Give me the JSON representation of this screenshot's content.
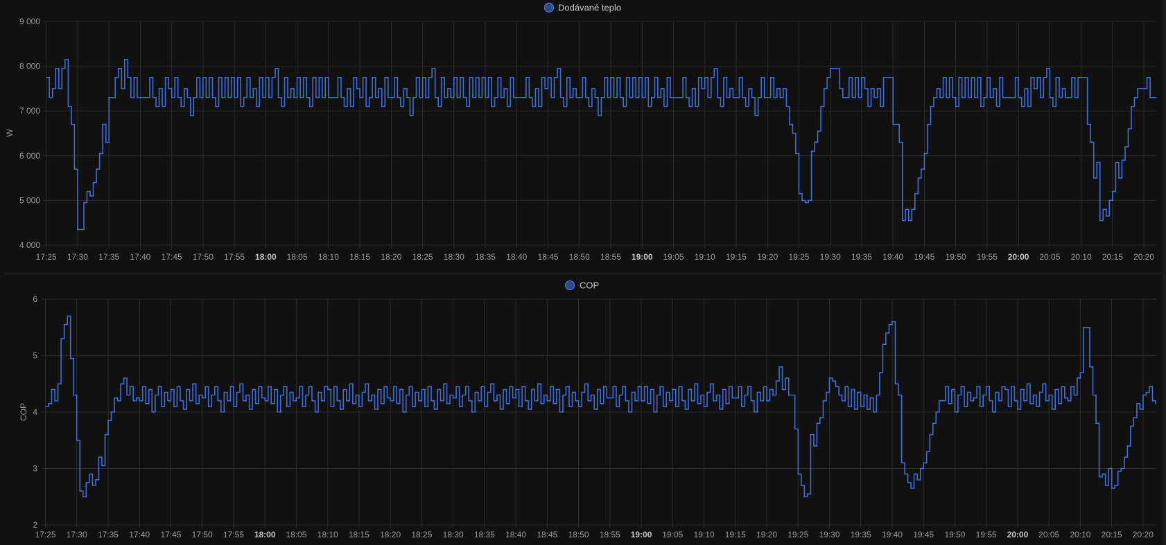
{
  "colors": {
    "background": "#111111",
    "line": "#3f6fd6",
    "legend_fill": "#2f4a8a",
    "grid": "#2c2c2c"
  },
  "chart_data": [
    {
      "type": "line",
      "step": true,
      "legend": "Dodávané teplo",
      "legend_placement": "top-center",
      "ylabel": "W",
      "xlabel": "",
      "ylim": [
        4000,
        9000
      ],
      "y_ticks": [
        {
          "v": 9000,
          "label": "9 000"
        },
        {
          "v": 8000,
          "label": "8 000"
        },
        {
          "v": 7000,
          "label": "7 000"
        },
        {
          "v": 6000,
          "label": "6 000"
        },
        {
          "v": 5000,
          "label": "5 000"
        },
        {
          "v": 4000,
          "label": "4 000"
        }
      ],
      "x_start": "17:25",
      "x_step_minutes": 0.5,
      "xlim_minutes": [
        0,
        177.5
      ],
      "values": [
        7750,
        7300,
        7500,
        7950,
        7500,
        7950,
        8150,
        7100,
        6700,
        5700,
        4350,
        4350,
        4950,
        5200,
        5100,
        5400,
        5700,
        6050,
        6700,
        6300,
        7300,
        7300,
        7750,
        7950,
        7500,
        8150,
        7750,
        7300,
        7750,
        7300,
        7300,
        7300,
        7300,
        7750,
        7300,
        7100,
        7500,
        7100,
        7750,
        7500,
        7300,
        7750,
        7300,
        7100,
        7500,
        7300,
        6900,
        7300,
        7750,
        7300,
        7750,
        7300,
        7750,
        7300,
        7100,
        7750,
        7300,
        7750,
        7300,
        7750,
        7300,
        7750,
        7100,
        7300,
        7750,
        7300,
        7500,
        7100,
        7750,
        7300,
        7750,
        7300,
        7750,
        7950,
        7300,
        7100,
        7750,
        7300,
        7500,
        7300,
        7750,
        7300,
        7750,
        7300,
        7100,
        7750,
        7300,
        7750,
        7300,
        7750,
        7300,
        7300,
        7300,
        7750,
        7300,
        7100,
        7500,
        7100,
        7750,
        7500,
        7300,
        7750,
        7100,
        7300,
        7750,
        7300,
        7500,
        7100,
        7750,
        7300,
        7300,
        7750,
        7300,
        7100,
        7500,
        7300,
        6900,
        7300,
        7750,
        7300,
        7750,
        7300,
        7750,
        7950,
        7300,
        7100,
        7750,
        7300,
        7500,
        7300,
        7750,
        7300,
        7750,
        7300,
        7100,
        7750,
        7300,
        7750,
        7300,
        7750,
        7300,
        7750,
        7100,
        7300,
        7750,
        7300,
        7500,
        7100,
        7750,
        7300,
        7300,
        7300,
        7300,
        7750,
        7300,
        7100,
        7500,
        7100,
        7750,
        7500,
        7750,
        7300,
        7750,
        7950,
        7300,
        7100,
        7750,
        7300,
        7500,
        7300,
        7300,
        7750,
        7300,
        7100,
        7500,
        7300,
        6900,
        7300,
        7750,
        7300,
        7750,
        7300,
        7750,
        7300,
        7100,
        7750,
        7300,
        7750,
        7300,
        7750,
        7300,
        7750,
        7100,
        7300,
        7750,
        7300,
        7500,
        7100,
        7750,
        7300,
        7300,
        7300,
        7300,
        7750,
        7300,
        7100,
        7500,
        7100,
        7750,
        7500,
        7750,
        7300,
        7750,
        7950,
        7300,
        7100,
        7750,
        7300,
        7500,
        7300,
        7300,
        7750,
        7300,
        7100,
        7500,
        7300,
        6900,
        7300,
        7750,
        7300,
        7300,
        7750,
        7300,
        7500,
        7300,
        7500,
        7100,
        6700,
        6500,
        6050,
        5150,
        5000,
        4950,
        5000,
        6100,
        6300,
        6550,
        7100,
        7500,
        7750,
        7950,
        7950,
        7950,
        7500,
        7300,
        7300,
        7750,
        7300,
        7750,
        7300,
        7750,
        7500,
        7100,
        7500,
        7300,
        7500,
        7100,
        7750,
        7750,
        7750,
        6700,
        6700,
        6300,
        4550,
        4800,
        4550,
        4800,
        5150,
        5500,
        5700,
        6050,
        6700,
        7100,
        7300,
        7500,
        7300,
        7750,
        7300,
        7750,
        7300,
        7100,
        7750,
        7300,
        7750,
        7300,
        7750,
        7300,
        7750,
        7100,
        7300,
        7750,
        7300,
        7500,
        7100,
        7750,
        7300,
        7300,
        7300,
        7300,
        7750,
        7300,
        7100,
        7500,
        7100,
        7750,
        7500,
        7750,
        7300,
        7750,
        7950,
        7300,
        7100,
        7750,
        7300,
        7500,
        7300,
        7300,
        7750,
        7300,
        7750,
        7750,
        7750,
        6700,
        6300,
        5500,
        5850,
        4550,
        4800,
        4650,
        5000,
        5200,
        5850,
        5500,
        5900,
        6200,
        6600,
        7100,
        7300,
        7500,
        7500,
        7500,
        7750,
        7300,
        7300,
        7300
      ],
      "x_ticks": [
        {
          "m": 0,
          "label": "17:25"
        },
        {
          "m": 5,
          "label": "17:30"
        },
        {
          "m": 10,
          "label": "17:35"
        },
        {
          "m": 15,
          "label": "17:40"
        },
        {
          "m": 20,
          "label": "17:45"
        },
        {
          "m": 25,
          "label": "17:50"
        },
        {
          "m": 30,
          "label": "17:55"
        },
        {
          "m": 35,
          "label": "18:00",
          "bold": true
        },
        {
          "m": 40,
          "label": "18:05"
        },
        {
          "m": 45,
          "label": "18:10"
        },
        {
          "m": 50,
          "label": "18:15"
        },
        {
          "m": 55,
          "label": "18:20"
        },
        {
          "m": 60,
          "label": "18:25"
        },
        {
          "m": 65,
          "label": "18:30"
        },
        {
          "m": 70,
          "label": "18:35"
        },
        {
          "m": 75,
          "label": "18:40"
        },
        {
          "m": 80,
          "label": "18:45"
        },
        {
          "m": 85,
          "label": "18:50"
        },
        {
          "m": 90,
          "label": "18:55"
        },
        {
          "m": 95,
          "label": "19:00",
          "bold": true
        },
        {
          "m": 100,
          "label": "19:05"
        },
        {
          "m": 105,
          "label": "19:10"
        },
        {
          "m": 110,
          "label": "19:15"
        },
        {
          "m": 115,
          "label": "19:20"
        },
        {
          "m": 120,
          "label": "19:25"
        },
        {
          "m": 125,
          "label": "19:30"
        },
        {
          "m": 130,
          "label": "19:35"
        },
        {
          "m": 135,
          "label": "19:40"
        },
        {
          "m": 140,
          "label": "19:45"
        },
        {
          "m": 145,
          "label": "19:50"
        },
        {
          "m": 150,
          "label": "19:55"
        },
        {
          "m": 155,
          "label": "20:00",
          "bold": true
        },
        {
          "m": 160,
          "label": "20:05"
        },
        {
          "m": 165,
          "label": "20:10"
        },
        {
          "m": 170,
          "label": "20:15"
        },
        {
          "m": 175,
          "label": "20:20"
        }
      ]
    },
    {
      "type": "line",
      "step": true,
      "legend": "COP",
      "legend_placement": "top-center",
      "ylabel": "COP",
      "xlabel": "",
      "ylim": [
        2,
        6
      ],
      "y_ticks": [
        {
          "v": 6,
          "label": "6"
        },
        {
          "v": 5,
          "label": "5"
        },
        {
          "v": 4,
          "label": "4"
        },
        {
          "v": 3,
          "label": "3"
        },
        {
          "v": 2,
          "label": "2"
        }
      ],
      "x_start": "17:25",
      "x_step_minutes": 0.5,
      "xlim_minutes": [
        0,
        177.5
      ],
      "values": [
        4.1,
        4.15,
        4.4,
        4.2,
        4.5,
        5.3,
        5.55,
        5.7,
        4.95,
        4.3,
        3.5,
        2.6,
        2.5,
        2.75,
        2.9,
        2.7,
        2.8,
        3.2,
        3.05,
        3.6,
        3.85,
        4.0,
        4.25,
        4.2,
        4.5,
        4.6,
        4.3,
        4.45,
        4.2,
        4.25,
        4.2,
        4.45,
        4.15,
        4.4,
        4.0,
        4.3,
        4.45,
        4.1,
        4.35,
        4.2,
        4.4,
        4.1,
        4.45,
        4.2,
        4.05,
        4.4,
        4.2,
        4.5,
        4.15,
        4.3,
        4.25,
        4.45,
        4.1,
        4.3,
        4.45,
        4.2,
        4.0,
        4.35,
        4.2,
        4.45,
        4.1,
        4.35,
        4.5,
        4.2,
        4.3,
        4.05,
        4.4,
        4.15,
        4.45,
        4.25,
        4.2,
        4.45,
        4.15,
        4.4,
        4.0,
        4.3,
        4.45,
        4.1,
        4.35,
        4.2,
        4.25,
        4.45,
        4.1,
        4.3,
        4.45,
        4.2,
        4.0,
        4.35,
        4.2,
        4.45,
        4.4,
        4.1,
        4.45,
        4.2,
        4.05,
        4.4,
        4.2,
        4.5,
        4.15,
        4.3,
        4.1,
        4.35,
        4.5,
        4.2,
        4.3,
        4.05,
        4.4,
        4.15,
        4.45,
        4.25,
        4.2,
        4.45,
        4.15,
        4.4,
        4.0,
        4.3,
        4.45,
        4.1,
        4.35,
        4.2,
        4.4,
        4.1,
        4.45,
        4.2,
        4.05,
        4.4,
        4.2,
        4.5,
        4.15,
        4.3,
        4.25,
        4.45,
        4.1,
        4.3,
        4.45,
        4.2,
        4.0,
        4.35,
        4.2,
        4.45,
        4.1,
        4.35,
        4.5,
        4.2,
        4.3,
        4.05,
        4.4,
        4.15,
        4.45,
        4.25,
        4.4,
        4.1,
        4.45,
        4.2,
        4.05,
        4.4,
        4.2,
        4.5,
        4.15,
        4.3,
        4.2,
        4.45,
        4.15,
        4.4,
        4.0,
        4.3,
        4.45,
        4.1,
        4.35,
        4.2,
        4.1,
        4.35,
        4.5,
        4.2,
        4.3,
        4.05,
        4.4,
        4.15,
        4.45,
        4.25,
        4.25,
        4.45,
        4.1,
        4.3,
        4.45,
        4.2,
        4.0,
        4.35,
        4.2,
        4.45,
        4.2,
        4.45,
        4.15,
        4.4,
        4.0,
        4.3,
        4.45,
        4.1,
        4.35,
        4.2,
        4.4,
        4.1,
        4.45,
        4.2,
        4.05,
        4.4,
        4.2,
        4.5,
        4.15,
        4.3,
        4.1,
        4.35,
        4.5,
        4.2,
        4.3,
        4.05,
        4.4,
        4.15,
        4.45,
        4.25,
        4.25,
        4.45,
        4.1,
        4.3,
        4.45,
        4.2,
        4.0,
        4.35,
        4.2,
        4.45,
        4.2,
        4.4,
        4.3,
        4.55,
        4.8,
        4.4,
        4.6,
        4.3,
        4.3,
        3.7,
        2.9,
        2.7,
        2.5,
        2.55,
        3.6,
        3.4,
        3.8,
        3.9,
        4.2,
        4.35,
        4.6,
        4.55,
        4.45,
        4.3,
        4.2,
        4.45,
        4.1,
        4.4,
        4.05,
        4.35,
        4.1,
        4.3,
        4.05,
        4.25,
        4.0,
        4.3,
        4.7,
        5.2,
        5.4,
        5.55,
        5.6,
        4.5,
        4.3,
        3.1,
        2.9,
        2.75,
        2.65,
        2.9,
        2.8,
        3.0,
        3.1,
        3.3,
        3.6,
        3.8,
        4.0,
        4.2,
        4.2,
        4.45,
        4.15,
        4.4,
        4.0,
        4.3,
        4.45,
        4.1,
        4.35,
        4.2,
        4.25,
        4.45,
        4.1,
        4.3,
        4.45,
        4.2,
        4.0,
        4.35,
        4.2,
        4.45,
        4.4,
        4.1,
        4.45,
        4.2,
        4.05,
        4.4,
        4.2,
        4.5,
        4.15,
        4.3,
        4.1,
        4.35,
        4.5,
        4.2,
        4.3,
        4.05,
        4.4,
        4.15,
        4.45,
        4.25,
        4.2,
        4.45,
        4.3,
        4.6,
        4.7,
        5.5,
        5.5,
        4.8,
        4.3,
        3.8,
        2.85,
        2.9,
        2.7,
        3.0,
        2.65,
        2.7,
        2.95,
        3.0,
        3.2,
        3.4,
        3.75,
        3.9,
        4.15,
        4.05,
        4.3,
        4.35,
        4.45,
        4.2,
        4.15
      ],
      "x_ticks": [
        {
          "m": 0,
          "label": "17:25"
        },
        {
          "m": 5,
          "label": "17:30"
        },
        {
          "m": 10,
          "label": "17:35"
        },
        {
          "m": 15,
          "label": "17:40"
        },
        {
          "m": 20,
          "label": "17:45"
        },
        {
          "m": 25,
          "label": "17:50"
        },
        {
          "m": 30,
          "label": "17:55"
        },
        {
          "m": 35,
          "label": "18:00",
          "bold": true
        },
        {
          "m": 40,
          "label": "18:05"
        },
        {
          "m": 45,
          "label": "18:10"
        },
        {
          "m": 50,
          "label": "18:15"
        },
        {
          "m": 55,
          "label": "18:20"
        },
        {
          "m": 60,
          "label": "18:25"
        },
        {
          "m": 65,
          "label": "18:30"
        },
        {
          "m": 70,
          "label": "18:35"
        },
        {
          "m": 75,
          "label": "18:40"
        },
        {
          "m": 80,
          "label": "18:45"
        },
        {
          "m": 85,
          "label": "18:50"
        },
        {
          "m": 90,
          "label": "18:55"
        },
        {
          "m": 95,
          "label": "19:00",
          "bold": true
        },
        {
          "m": 100,
          "label": "19:05"
        },
        {
          "m": 105,
          "label": "19:10"
        },
        {
          "m": 110,
          "label": "19:15"
        },
        {
          "m": 115,
          "label": "19:20"
        },
        {
          "m": 120,
          "label": "19:25"
        },
        {
          "m": 125,
          "label": "19:30"
        },
        {
          "m": 130,
          "label": "19:35"
        },
        {
          "m": 135,
          "label": "19:40"
        },
        {
          "m": 140,
          "label": "19:45"
        },
        {
          "m": 145,
          "label": "19:50"
        },
        {
          "m": 150,
          "label": "19:55"
        },
        {
          "m": 155,
          "label": "20:00",
          "bold": true
        },
        {
          "m": 160,
          "label": "20:05"
        },
        {
          "m": 165,
          "label": "20:10"
        },
        {
          "m": 170,
          "label": "20:15"
        },
        {
          "m": 175,
          "label": "20:20"
        }
      ]
    }
  ]
}
